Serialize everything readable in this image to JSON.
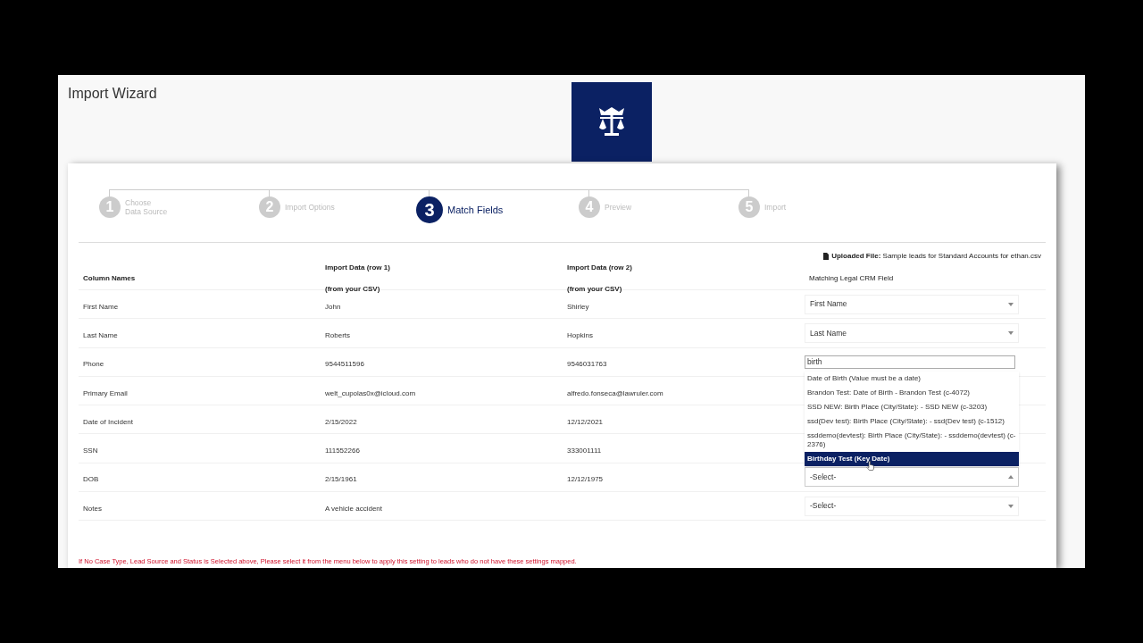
{
  "page": {
    "title": "Import Wizard"
  },
  "steps": [
    {
      "number": "1",
      "label": "Choose\nData Source",
      "selected": false
    },
    {
      "number": "2",
      "label": "Import Options",
      "selected": false
    },
    {
      "number": "3",
      "label": "Match Fields",
      "selected": true
    },
    {
      "number": "4",
      "label": "Preview",
      "selected": false
    },
    {
      "number": "5",
      "label": "Import",
      "selected": false
    }
  ],
  "uploaded_file": {
    "label": "Uploaded File:",
    "name": "Sample leads for Standard Accounts for ethan.csv"
  },
  "table": {
    "columns": [
      "Column Names",
      "Import Data (row 1)\n(from your CSV)",
      "Import Data (row 2)\n(from your CSV)",
      "Matching Legal CRM Field"
    ],
    "rows": [
      {
        "name": "First Name",
        "row1": "John",
        "row2": "Shirley",
        "mapping": {
          "kind": "select",
          "value": "First Name",
          "open": false
        }
      },
      {
        "name": "Last Name",
        "row1": "Roberts",
        "row2": "Hopkins",
        "mapping": {
          "kind": "select",
          "value": "Last Name",
          "open": false
        }
      },
      {
        "name": "Phone",
        "row1": "9544511596",
        "row2": "9546031763",
        "mapping": {
          "kind": "search",
          "value": "birth",
          "options": [
            {
              "label": "Date of Birth (Value must be a date)",
              "selected": false
            },
            {
              "label": "Brandon Test: Date of Birth - Brandon Test (c-4072)",
              "selected": false
            },
            {
              "label": "SSD NEW: Birth Place (City/State): - SSD NEW (c-3203)",
              "selected": false
            },
            {
              "label": "ssd(Dev test): Birth Place (City/State): - ssd(Dev test) (c-1512)",
              "selected": false
            },
            {
              "label": "ssddemo(devtest): Birth Place (City/State): - ssddemo(devtest) (c-2376)",
              "selected": false
            },
            {
              "label": "Birthday Test (Key Date)",
              "selected": true
            }
          ]
        }
      },
      {
        "name": "Primary Email",
        "row1": "welt_cupolas0x@icloud.com",
        "row2": "alfredo.fonseca@lawruler.com"
      },
      {
        "name": "Date of Incident",
        "row1": "2/15/2022",
        "row2": "12/12/2021"
      },
      {
        "name": "SSN",
        "row1": "111552266",
        "row2": "333001111"
      },
      {
        "name": "DOB",
        "row1": "2/15/1961",
        "row2": "12/12/1975",
        "mapping": {
          "kind": "select",
          "value": "-Select-",
          "open": true
        }
      },
      {
        "name": "Notes",
        "row1": "A vehicle accident",
        "mapping": {
          "kind": "select",
          "value": "-Select-",
          "open": false
        }
      }
    ]
  },
  "notice": "If No Case Type, Lead Source and Status is Selected above, Please select it from the menu below to apply this setting to leads who do not have these settings mapped."
}
